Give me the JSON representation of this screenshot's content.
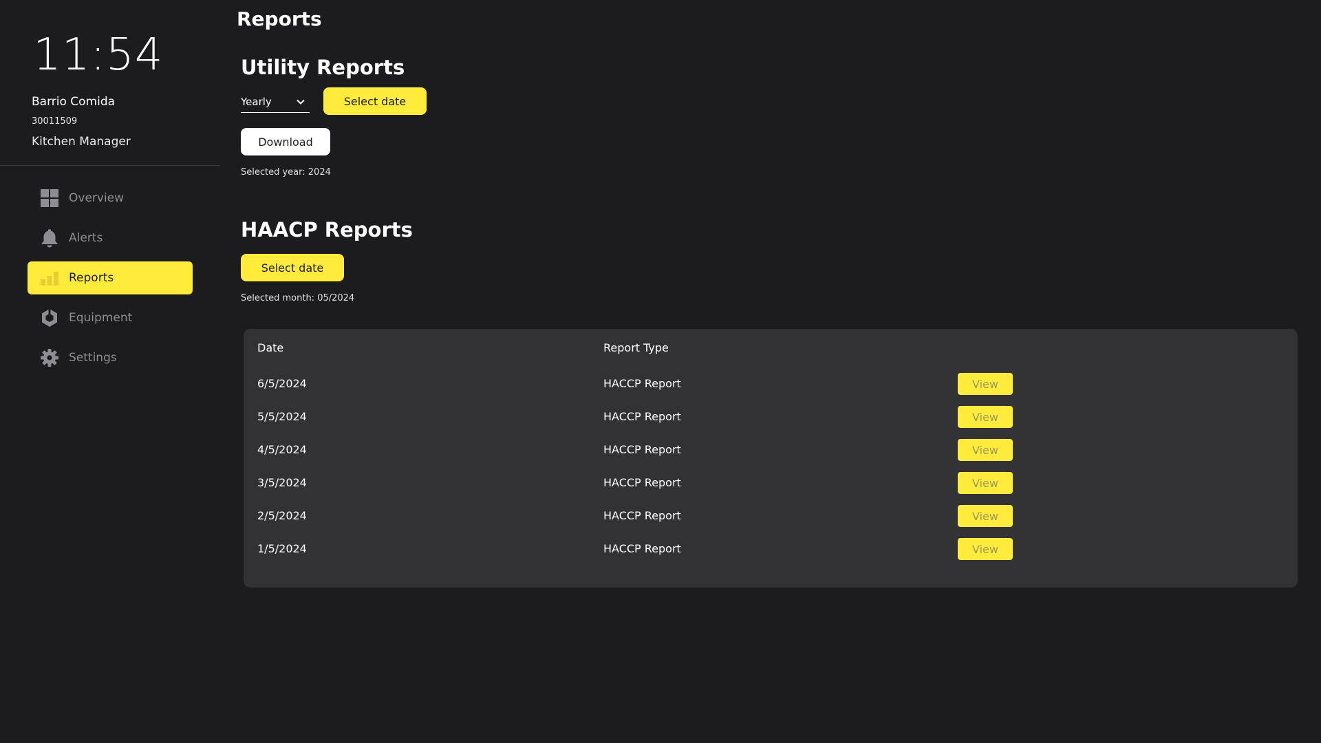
{
  "sidebar": {
    "clock": "11:54",
    "user": {
      "name": "Barrio Comida",
      "id": "30011509",
      "role": "Kitchen Manager"
    },
    "nav": [
      {
        "label": "Overview",
        "icon": "grid-icon",
        "active": false
      },
      {
        "label": "Alerts",
        "icon": "bell-icon",
        "active": false
      },
      {
        "label": "Reports",
        "icon": "bar-chart-icon",
        "active": true
      },
      {
        "label": "Equipment",
        "icon": "hexagon-icon",
        "active": false
      },
      {
        "label": "Settings",
        "icon": "gear-icon",
        "active": false
      }
    ]
  },
  "main": {
    "page_title": "Reports",
    "utility": {
      "title": "Utility Reports",
      "period_select": {
        "value": "Yearly"
      },
      "select_date_label": "Select date",
      "download_label": "Download",
      "selected_note": "Selected year: 2024"
    },
    "haacp": {
      "title": "HAACP Reports",
      "select_date_label": "Select date",
      "selected_note": "Selected month: 05/2024"
    },
    "table": {
      "headers": [
        "Date",
        "Report Type"
      ],
      "rows": [
        {
          "date": "6/5/2024",
          "type": "HACCP Report",
          "action": "View"
        },
        {
          "date": "5/5/2024",
          "type": "HACCP Report",
          "action": "View"
        },
        {
          "date": "4/5/2024",
          "type": "HACCP Report",
          "action": "View"
        },
        {
          "date": "3/5/2024",
          "type": "HACCP Report",
          "action": "View"
        },
        {
          "date": "2/5/2024",
          "type": "HACCP Report",
          "action": "View"
        },
        {
          "date": "1/5/2024",
          "type": "HACCP Report",
          "action": "View"
        }
      ]
    }
  },
  "colors": {
    "background": "#1c1c1e",
    "accent": "#ffeb3b",
    "card": "#323235",
    "muted_text": "#8d8d92"
  }
}
